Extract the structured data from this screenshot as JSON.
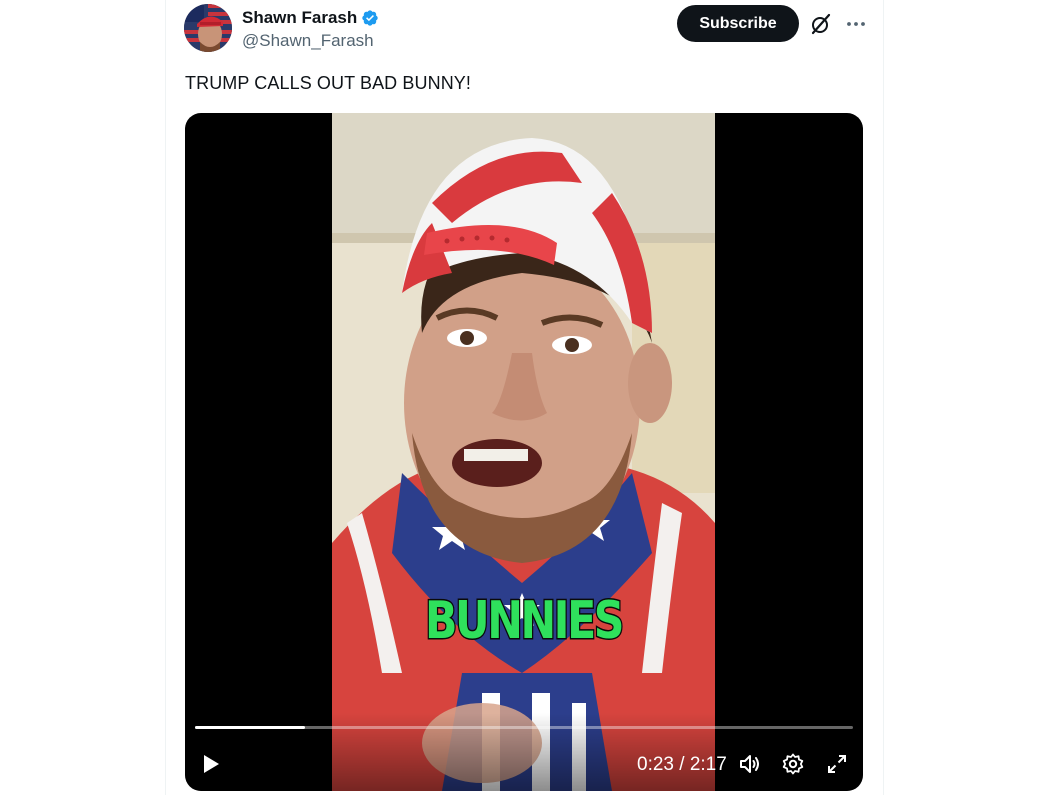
{
  "post": {
    "author": {
      "display_name": "Shawn Farash",
      "handle": "@Shawn_Farash",
      "verified": true
    },
    "subscribe_label": "Subscribe",
    "text": "TRUMP CALLS OUT BAD BUNNY!",
    "video": {
      "caption": "BUNNIES",
      "current_time": "0:23",
      "duration": "2:17",
      "time_display": "0:23 / 2:17",
      "progress": 0.167
    }
  },
  "colors": {
    "brand_verified": "#1d9bf0",
    "subscribe_bg": "#0f1419",
    "caption_green": "#2fe05c",
    "text_primary": "#0f1419",
    "text_secondary": "#536471"
  },
  "icons": {
    "verified": "verified-badge-icon",
    "grok": "grok-icon",
    "more": "more-icon",
    "play": "play-icon",
    "volume": "volume-icon",
    "settings": "settings-icon",
    "fullscreen": "fullscreen-icon"
  }
}
